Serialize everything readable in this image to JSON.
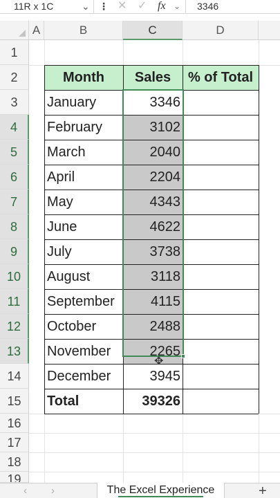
{
  "formula_bar": {
    "name_box": "11R x 1C",
    "name_box_arrow": "⌄",
    "menu_dots": "⋮",
    "cancel_glyph": "✕",
    "enter_glyph": "✓",
    "fx_label": "fx",
    "fx_arrow": "⌄",
    "value": "3346"
  },
  "columns": [
    "A",
    "B",
    "C",
    "D"
  ],
  "rows": [
    "1",
    "2",
    "3",
    "4",
    "5",
    "6",
    "7",
    "8",
    "9",
    "10",
    "11",
    "12",
    "13",
    "14",
    "15",
    "16",
    "17",
    "18",
    "19"
  ],
  "table": {
    "headers": {
      "month": "Month",
      "sales": "Sales",
      "pct": "% of Total"
    },
    "data": [
      {
        "month": "January",
        "sales": "3346"
      },
      {
        "month": "February",
        "sales": "3102"
      },
      {
        "month": "March",
        "sales": "2040"
      },
      {
        "month": "April",
        "sales": "2204"
      },
      {
        "month": "May",
        "sales": "4343"
      },
      {
        "month": "June",
        "sales": "4622"
      },
      {
        "month": "July",
        "sales": "3738"
      },
      {
        "month": "August",
        "sales": "3118"
      },
      {
        "month": "September",
        "sales": "4115"
      },
      {
        "month": "October",
        "sales": "2488"
      },
      {
        "month": "November",
        "sales": "2265"
      },
      {
        "month": "December",
        "sales": "3945"
      }
    ],
    "total": {
      "label": "Total",
      "value": "39326"
    }
  },
  "sheet_bar": {
    "prev": "‹",
    "next": "›",
    "active_tab": "The Excel Experience",
    "add": "+"
  },
  "colors": {
    "header_fill": "#c6efce",
    "selection_border": "#3f8a55",
    "selection_fill": "#c9c9c9"
  },
  "icons": {
    "name_box_dropdown": "chevron-down-icon",
    "cancel": "close-icon",
    "enter": "check-icon",
    "function": "fx-icon",
    "add_sheet": "plus-icon",
    "cursor": "move-cursor-icon"
  }
}
